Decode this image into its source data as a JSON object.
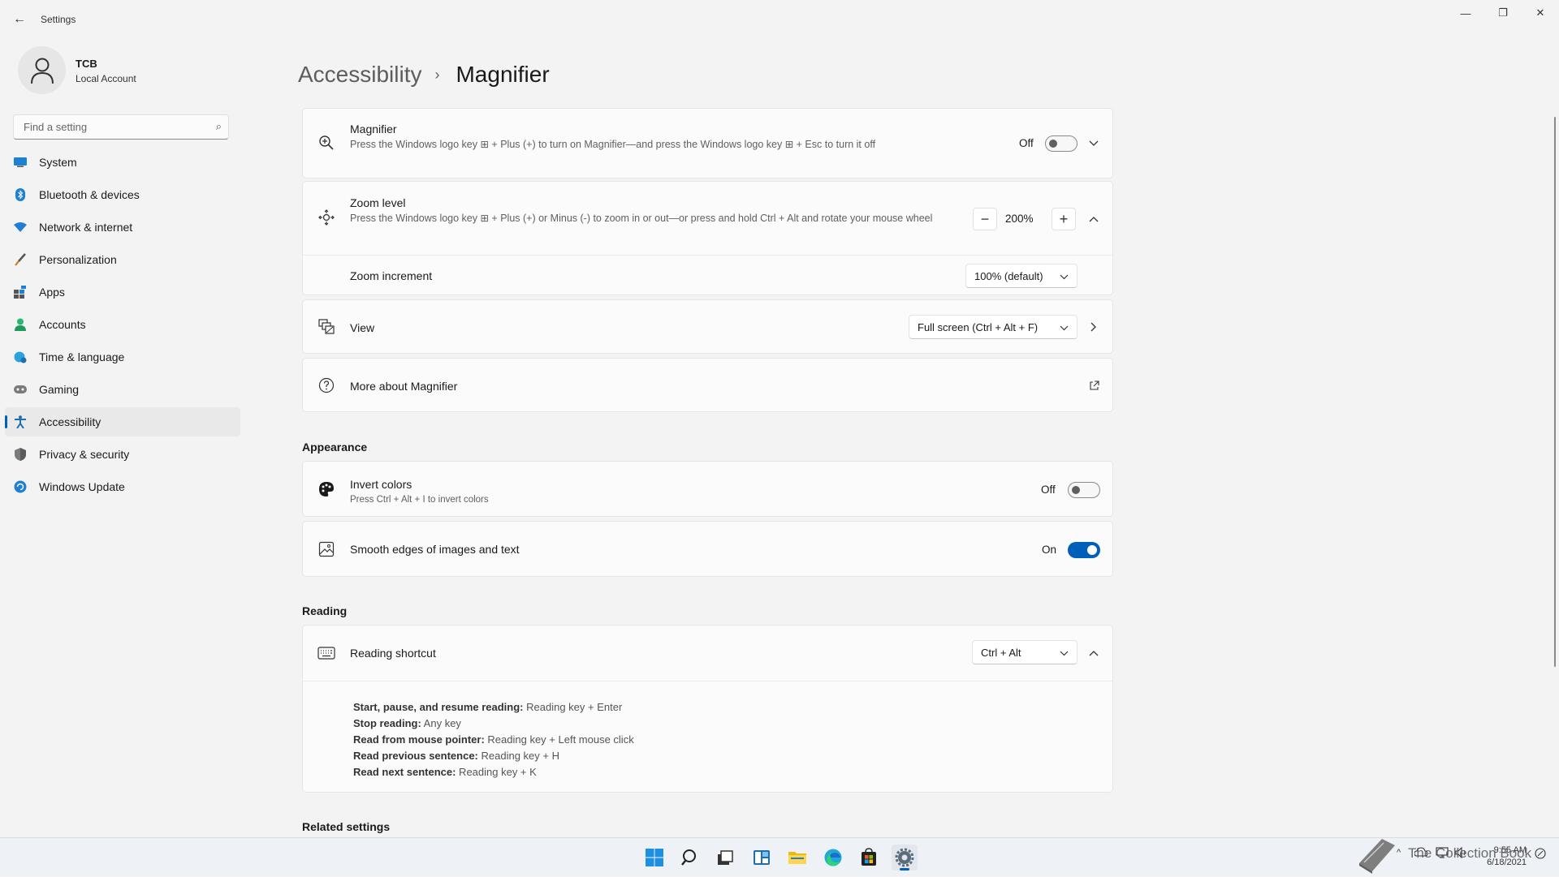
{
  "window": {
    "title": "Settings",
    "back_glyph": "←",
    "minimize_glyph": "—",
    "maximize_glyph": "❐",
    "close_glyph": "✕"
  },
  "profile": {
    "name": "TCB",
    "account_type": "Local Account"
  },
  "search": {
    "placeholder": "Find a setting",
    "icon": "search-icon",
    "icon_glyph": "⌕"
  },
  "sidebar": {
    "items": [
      {
        "label": "System",
        "icon": "system-icon",
        "active": false
      },
      {
        "label": "Bluetooth & devices",
        "icon": "bluetooth-icon",
        "active": false
      },
      {
        "label": "Network & internet",
        "icon": "wifi-icon",
        "active": false
      },
      {
        "label": "Personalization",
        "icon": "brush-icon",
        "active": false
      },
      {
        "label": "Apps",
        "icon": "apps-icon",
        "active": false
      },
      {
        "label": "Accounts",
        "icon": "person-icon",
        "active": false
      },
      {
        "label": "Time & language",
        "icon": "globe-clock-icon",
        "active": false
      },
      {
        "label": "Gaming",
        "icon": "gamepad-icon",
        "active": false
      },
      {
        "label": "Accessibility",
        "icon": "accessibility-icon",
        "active": true
      },
      {
        "label": "Privacy & security",
        "icon": "shield-icon",
        "active": false
      },
      {
        "label": "Windows Update",
        "icon": "update-icon",
        "active": false
      }
    ]
  },
  "breadcrumb": {
    "parent": "Accessibility",
    "separator": "›",
    "current": "Magnifier"
  },
  "magnifier": {
    "title": "Magnifier",
    "description": "Press the Windows logo key ⊞ + Plus (+) to turn on Magnifier—and press the Windows logo key ⊞ + Esc to turn it off",
    "state_label": "Off",
    "toggle_on": false
  },
  "zoom_level": {
    "title": "Zoom level",
    "description": "Press the Windows logo key ⊞ + Plus (+) or Minus (-) to zoom in or out—or press and hold Ctrl + Alt and rotate your mouse wheel",
    "minus": "−",
    "value": "200%",
    "plus": "+"
  },
  "zoom_increment": {
    "title": "Zoom increment",
    "selected": "100% (default)"
  },
  "view": {
    "title": "View",
    "selected": "Full screen (Ctrl + Alt + F)"
  },
  "more_about": {
    "title": "More about Magnifier"
  },
  "appearance": {
    "heading": "Appearance",
    "invert": {
      "title": "Invert colors",
      "description": "Press Ctrl + Alt + I to invert colors",
      "state_label": "Off",
      "toggle_on": false
    },
    "smooth": {
      "title": "Smooth edges of images and text",
      "state_label": "On",
      "toggle_on": true
    }
  },
  "reading": {
    "heading": "Reading",
    "shortcut_title": "Reading shortcut",
    "shortcut_selected": "Ctrl + Alt",
    "shortcuts": [
      {
        "label": "Start, pause, and resume reading:",
        "value": " Reading key + Enter"
      },
      {
        "label": "Stop reading:",
        "value": " Any key"
      },
      {
        "label": "Read from mouse pointer:",
        "value": " Reading key + Left mouse click"
      },
      {
        "label": "Read previous sentence:",
        "value": " Reading key + H"
      },
      {
        "label": "Read next sentence:",
        "value": " Reading key + K"
      }
    ]
  },
  "related": {
    "heading": "Related settings"
  },
  "taskbar": {
    "time": "9:55 AM",
    "date": "6/18/2021",
    "tray_chevron": "^",
    "watermark": "The Collection Book"
  },
  "colors": {
    "accent": "#005fb8",
    "background": "#f3f3f3",
    "card": "#fbfbfb"
  }
}
